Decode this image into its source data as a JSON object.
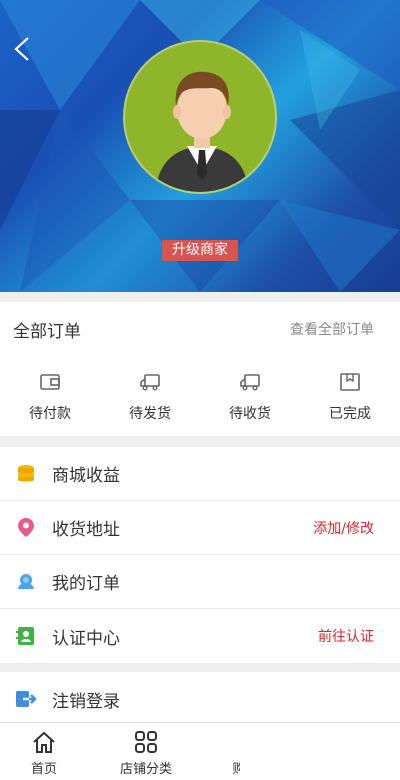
{
  "header": {
    "upgrade_label": "升级商家"
  },
  "orders": {
    "title": "全部订单",
    "view_all": "查看全部订单",
    "items": [
      {
        "label": "待付款",
        "icon": "wallet-icon"
      },
      {
        "label": "待发货",
        "icon": "truck-icon"
      },
      {
        "label": "待收货",
        "icon": "truck-icon"
      },
      {
        "label": "已完成",
        "icon": "box-icon"
      }
    ]
  },
  "menu": {
    "items": [
      {
        "label": "商城收益",
        "extra": "",
        "icon": "coins-icon"
      },
      {
        "label": "收货地址",
        "extra": "添加/修改",
        "icon": "location-pin-icon"
      },
      {
        "label": "我的订单",
        "extra": "",
        "icon": "orders-icon"
      },
      {
        "label": "认证中心",
        "extra": "前往认证",
        "icon": "contact-card-icon"
      }
    ],
    "logout_label": "注销登录"
  },
  "tabbar": {
    "items": [
      {
        "label": "首页",
        "icon": "home-icon"
      },
      {
        "label": "店铺分类",
        "icon": "grid-icon"
      },
      {
        "label": "购",
        "icon": "cart-icon"
      }
    ]
  },
  "colors": {
    "accent_red": "#e0262c",
    "upgrade_bg": "#d9534f",
    "avatar_bg": "#8fb62a"
  }
}
